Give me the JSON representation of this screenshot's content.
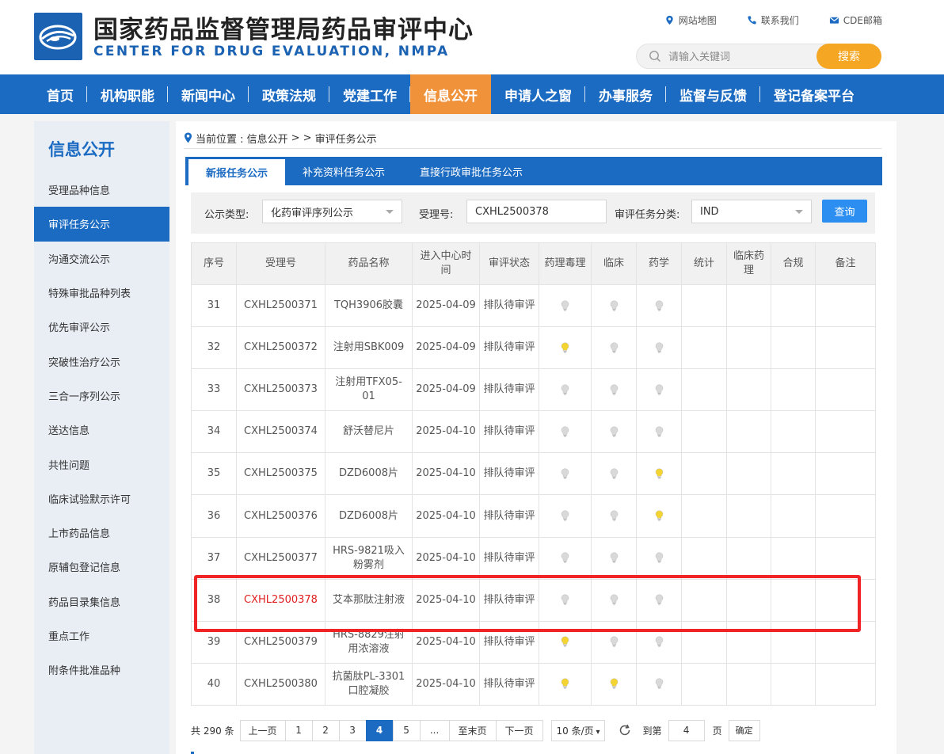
{
  "header": {
    "title": "国家药品监督管理局药品审评中心",
    "subtitle": "CENTER FOR DRUG EVALUATION, NMPA",
    "links": [
      {
        "label": "网站地图",
        "icon": "location-icon"
      },
      {
        "label": "联系我们",
        "icon": "phone-icon"
      },
      {
        "label": "CDE邮箱",
        "icon": "mail-icon"
      }
    ],
    "search": {
      "placeholder": "请输入关键词",
      "button": "搜索"
    }
  },
  "nav": {
    "items": [
      "首页",
      "机构职能",
      "新闻中心",
      "政策法规",
      "党建工作",
      "信息公开",
      "申请人之窗",
      "办事服务",
      "监督与反馈",
      "登记备案平台"
    ],
    "active": "信息公开"
  },
  "sidebar": {
    "title": "信息公开",
    "items": [
      "受理品种信息",
      "审评任务公示",
      "沟通交流公示",
      "特殊审批品种列表",
      "优先审评公示",
      "突破性治疗公示",
      "三合一序列公示",
      "送达信息",
      "共性问题",
      "临床试验默示许可",
      "上市药品信息",
      "原辅包登记信息",
      "药品目录集信息",
      "重点工作",
      "附条件批准品种"
    ],
    "active": "审评任务公示"
  },
  "breadcrumb": {
    "prefix": "当前位置 : 信息公开",
    "separator": "> >",
    "current": "审评任务公示"
  },
  "tabs": [
    "新报任务公示",
    "补充资料任务公示",
    "直接行政审批任务公示"
  ],
  "filter": {
    "type_label": "公示类型:",
    "type_value": "化药审评序列公示",
    "accept_label": "受理号:",
    "accept_value": "CXHL2500378",
    "category_label": "审评任务分类:",
    "category_value": "IND",
    "query_button": "查询"
  },
  "table": {
    "headers": [
      "序号",
      "受理号",
      "药品名称",
      "进入中心时间",
      "审评状态",
      "药理毒理",
      "临床",
      "药学",
      "统计",
      "临床药理",
      "合规",
      "备注"
    ],
    "rows": [
      {
        "no": "31",
        "id": "CXHL2500371",
        "name": "TQH3906胶囊",
        "date": "2025-04-09",
        "status": "排队待审评",
        "pharm": "off",
        "clin": "off",
        "chem": "off"
      },
      {
        "no": "32",
        "id": "CXHL2500372",
        "name": "注射用SBK009",
        "date": "2025-04-09",
        "status": "排队待审评",
        "pharm": "on",
        "clin": "off",
        "chem": "off"
      },
      {
        "no": "33",
        "id": "CXHL2500373",
        "name": "注射用TFX05-01",
        "date": "2025-04-09",
        "status": "排队待审评",
        "pharm": "off",
        "clin": "off",
        "chem": "off"
      },
      {
        "no": "34",
        "id": "CXHL2500374",
        "name": "舒沃替尼片",
        "date": "2025-04-10",
        "status": "排队待审评",
        "pharm": "off",
        "clin": "off",
        "chem": "off"
      },
      {
        "no": "35",
        "id": "CXHL2500375",
        "name": "DZD6008片",
        "date": "2025-04-10",
        "status": "排队待审评",
        "pharm": "off",
        "clin": "off",
        "chem": "on"
      },
      {
        "no": "36",
        "id": "CXHL2500376",
        "name": "DZD6008片",
        "date": "2025-04-10",
        "status": "排队待审评",
        "pharm": "off",
        "clin": "off",
        "chem": "on"
      },
      {
        "no": "37",
        "id": "CXHL2500377",
        "name": "HRS-9821吸入粉雾剂",
        "date": "2025-04-10",
        "status": "排队待审评",
        "pharm": "off",
        "clin": "off",
        "chem": "off"
      },
      {
        "no": "38",
        "id": "CXHL2500378",
        "name": "艾本那肽注射液",
        "date": "2025-04-10",
        "status": "排队待审评",
        "pharm": "off",
        "clin": "off",
        "chem": "off",
        "highlight": true
      },
      {
        "no": "39",
        "id": "CXHL2500379",
        "name": "HRS-8829注射用浓溶液",
        "date": "2025-04-10",
        "status": "排队待审评",
        "pharm": "on",
        "clin": "off",
        "chem": "off"
      },
      {
        "no": "40",
        "id": "CXHL2500380",
        "name": "抗菌肽PL-3301口腔凝胶",
        "date": "2025-04-10",
        "status": "排队待审评",
        "pharm": "on",
        "clin": "on",
        "chem": "off"
      }
    ]
  },
  "pager": {
    "total": "共 290 条",
    "prev": "上一页",
    "pages": [
      "1",
      "2",
      "3",
      "4",
      "5",
      "..."
    ],
    "current": "4",
    "last": "至末页",
    "next": "下一页",
    "page_size": "10 条/页",
    "goto": "到第",
    "goto_value": "4",
    "page_unit": "页",
    "confirm": "确定"
  },
  "colors": {
    "primary": "#1b6bc2",
    "accent": "#f0923a",
    "search": "#f5a623",
    "bulb_on": "#f3d430",
    "bulb_off": "#d9d9d9",
    "highlight": "#f02424"
  }
}
